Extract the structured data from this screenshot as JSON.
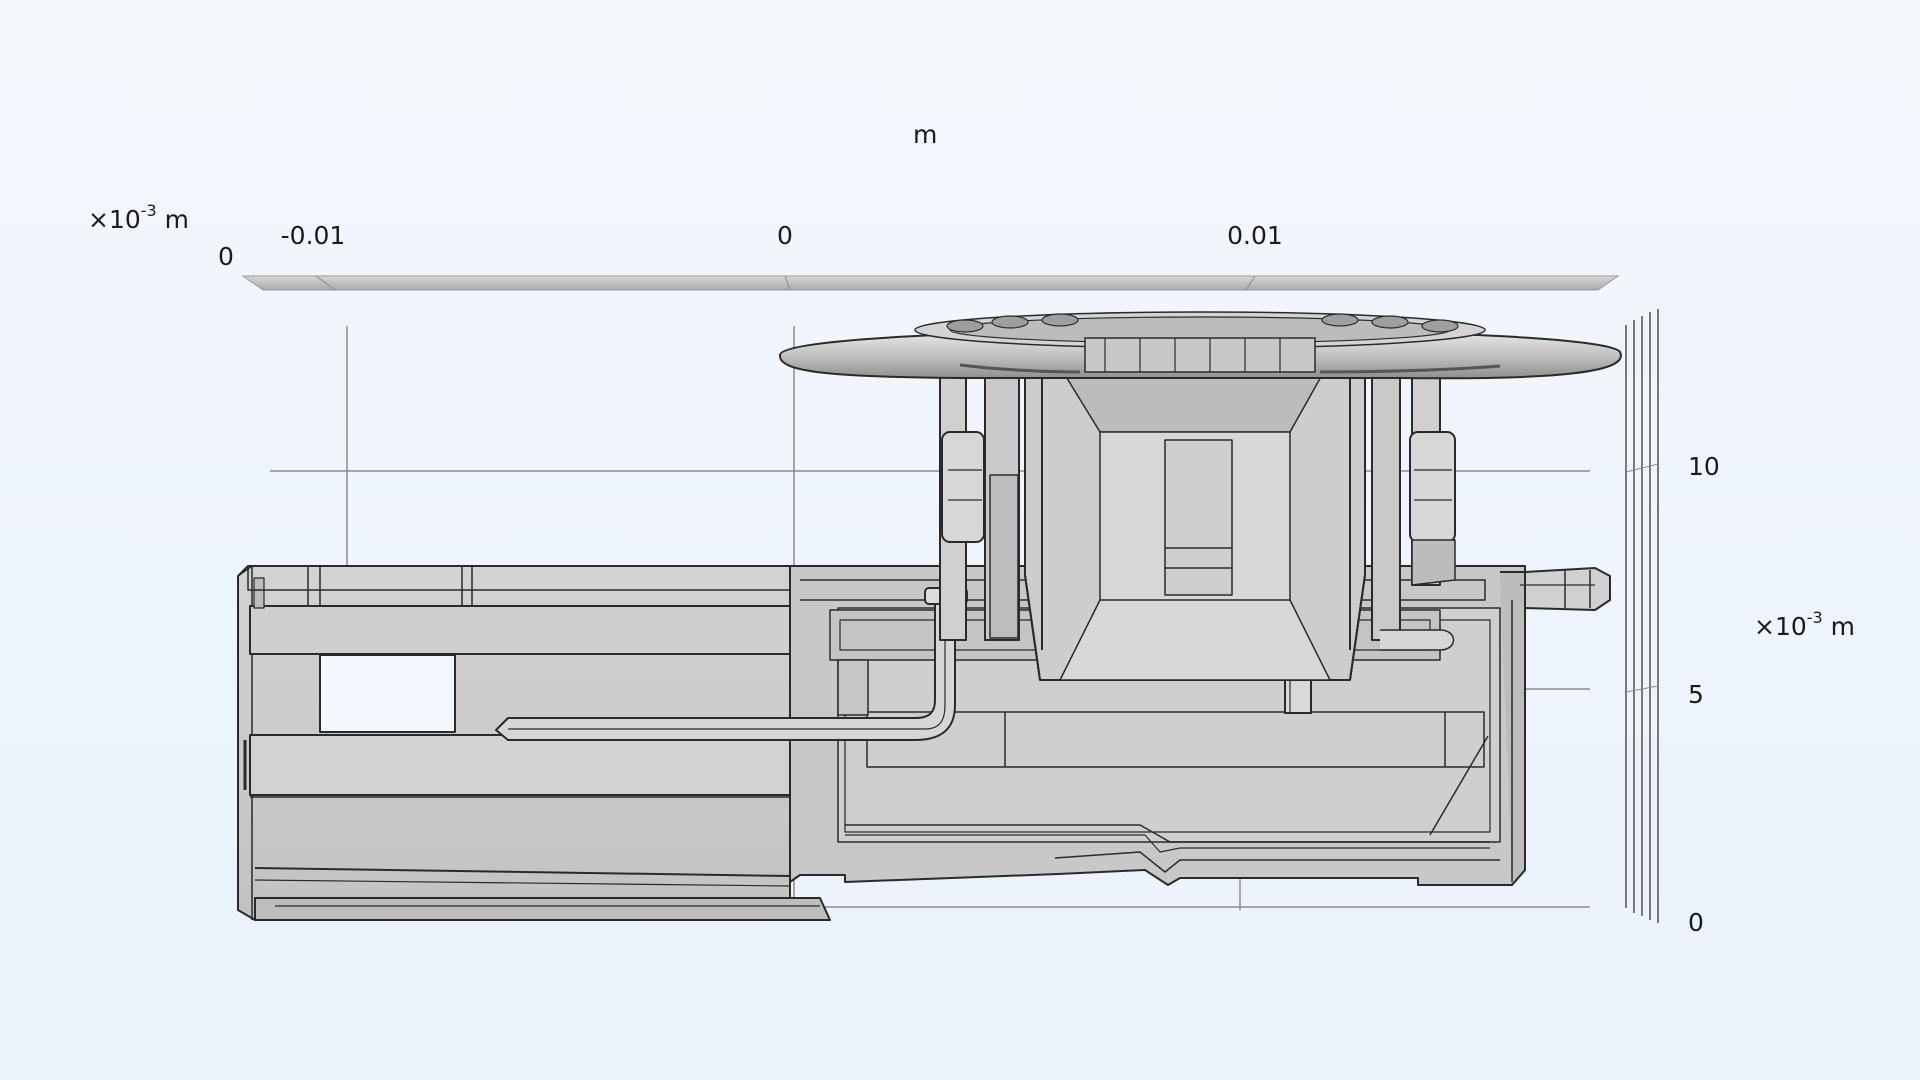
{
  "view": {
    "background_top": "#f4f8fd",
    "background_bottom": "#eaf2fc",
    "part_fill": "#cbcbcb",
    "part_fill_light": "#d9d9d9",
    "part_fill_dark": "#b3b3b3",
    "edge_color": "#2a2a2a",
    "grid_color": "#8a8a8a"
  },
  "axes": {
    "x_top": {
      "unit_label": "m",
      "ticks": [
        "-0.01",
        "0",
        "0.01"
      ]
    },
    "y_left": {
      "unit_prefix": "×10",
      "unit_exp": "-3",
      "unit_suffix": "m",
      "ticks": [
        "0"
      ]
    },
    "y_right": {
      "unit_prefix": "×10",
      "unit_exp": "-3",
      "unit_suffix": "m",
      "ticks": [
        "10",
        "5",
        "0"
      ]
    }
  }
}
